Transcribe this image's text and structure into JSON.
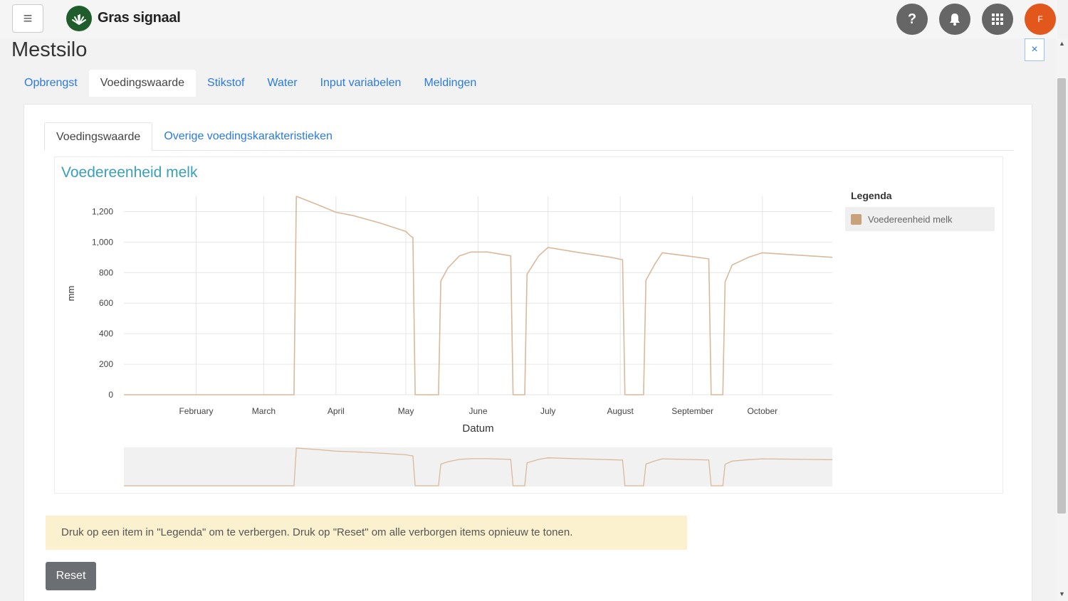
{
  "header": {
    "menu_icon": "hamburger-icon",
    "logo_icon": "grass-icon",
    "app_title": "Gras signaal",
    "help_label": "?",
    "notifications_icon": "bell-icon",
    "apps_icon": "grid-icon",
    "avatar_initial": "F"
  },
  "page": {
    "title": "Mestsilo",
    "close_label": "×"
  },
  "tabs": [
    {
      "label": "Opbrengst",
      "active": false
    },
    {
      "label": "Voedingswaarde",
      "active": true
    },
    {
      "label": "Stikstof",
      "active": false
    },
    {
      "label": "Water",
      "active": false
    },
    {
      "label": "Input variabelen",
      "active": false
    },
    {
      "label": "Meldingen",
      "active": false
    }
  ],
  "subtabs": [
    {
      "label": "Voedingswaarde",
      "active": true
    },
    {
      "label": "Overige voedingskarakteristieken",
      "active": false
    }
  ],
  "legend": {
    "title": "Legenda",
    "items": [
      {
        "label": "Voedereenheid melk",
        "color": "#c8a27a"
      }
    ]
  },
  "chart_data": {
    "type": "line",
    "title": "Voedereenheid melk",
    "xlabel": "Datum",
    "ylabel": "mm",
    "ylim": [
      0,
      1300
    ],
    "yticks": [
      0,
      200,
      400,
      600,
      800,
      1000,
      1200
    ],
    "ytick_labels": [
      "0",
      "200",
      "400",
      "600",
      "800",
      "1,000",
      "1,200"
    ],
    "xlim": [
      "2024-01-01",
      "2024-10-31"
    ],
    "xtick_labels": [
      "February",
      "March",
      "April",
      "May",
      "June",
      "July",
      "August",
      "September",
      "October"
    ],
    "xtick_dates": [
      "2024-02-01",
      "2024-03-01",
      "2024-04-01",
      "2024-05-01",
      "2024-06-01",
      "2024-07-01",
      "2024-08-01",
      "2024-09-01",
      "2024-10-01"
    ],
    "grid": true,
    "legend_position": "right",
    "navigator": true,
    "series": [
      {
        "name": "Voedereenheid melk",
        "color": "#d9b99a",
        "points": [
          [
            "2024-01-01",
            0
          ],
          [
            "2024-03-14",
            0
          ],
          [
            "2024-03-15",
            1300
          ],
          [
            "2024-03-25",
            1240
          ],
          [
            "2024-04-01",
            1195
          ],
          [
            "2024-04-08",
            1175
          ],
          [
            "2024-04-20",
            1125
          ],
          [
            "2024-05-01",
            1070
          ],
          [
            "2024-05-03",
            1040
          ],
          [
            "2024-05-04",
            1030
          ],
          [
            "2024-05-05",
            0
          ],
          [
            "2024-05-15",
            0
          ],
          [
            "2024-05-16",
            745
          ],
          [
            "2024-05-19",
            830
          ],
          [
            "2024-05-24",
            910
          ],
          [
            "2024-05-29",
            935
          ],
          [
            "2024-06-05",
            935
          ],
          [
            "2024-06-15",
            910
          ],
          [
            "2024-06-16",
            0
          ],
          [
            "2024-06-21",
            0
          ],
          [
            "2024-06-22",
            790
          ],
          [
            "2024-06-27",
            910
          ],
          [
            "2024-07-01",
            965
          ],
          [
            "2024-07-15",
            930
          ],
          [
            "2024-07-28",
            900
          ],
          [
            "2024-08-02",
            885
          ],
          [
            "2024-08-03",
            0
          ],
          [
            "2024-08-11",
            0
          ],
          [
            "2024-08-12",
            750
          ],
          [
            "2024-08-16",
            860
          ],
          [
            "2024-08-19",
            930
          ],
          [
            "2024-09-01",
            905
          ],
          [
            "2024-09-08",
            890
          ],
          [
            "2024-09-09",
            0
          ],
          [
            "2024-09-14",
            0
          ],
          [
            "2024-09-15",
            740
          ],
          [
            "2024-09-18",
            850
          ],
          [
            "2024-09-25",
            900
          ],
          [
            "2024-10-01",
            930
          ],
          [
            "2024-10-31",
            900
          ]
        ]
      }
    ]
  },
  "notice_text": "Druk op een item in \"Legenda\" om te verbergen. Druk op \"Reset\" om alle verborgen items opnieuw te tonen.",
  "reset_label": "Reset"
}
